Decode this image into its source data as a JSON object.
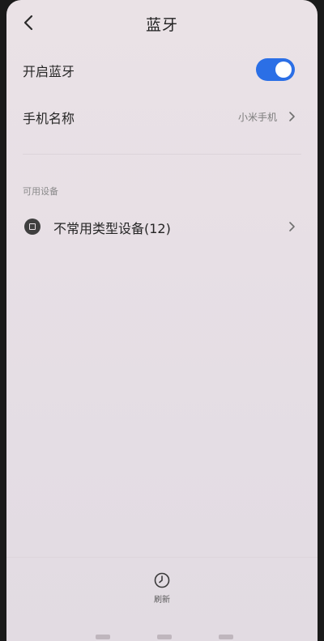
{
  "header": {
    "title": "蓝牙",
    "back_icon": "chevron-left-icon"
  },
  "bluetooth_toggle": {
    "label": "开启蓝牙",
    "enabled": true,
    "accent_color": "#2b6fe6"
  },
  "device_name": {
    "label": "手机名称",
    "value": "小米手机"
  },
  "available_devices": {
    "section_title": "可用设备",
    "items": [
      {
        "label": "不常用类型设备(12)",
        "icon": "device-icon"
      }
    ]
  },
  "footer": {
    "refresh_label": "刷新",
    "refresh_icon": "refresh-clock-icon"
  }
}
